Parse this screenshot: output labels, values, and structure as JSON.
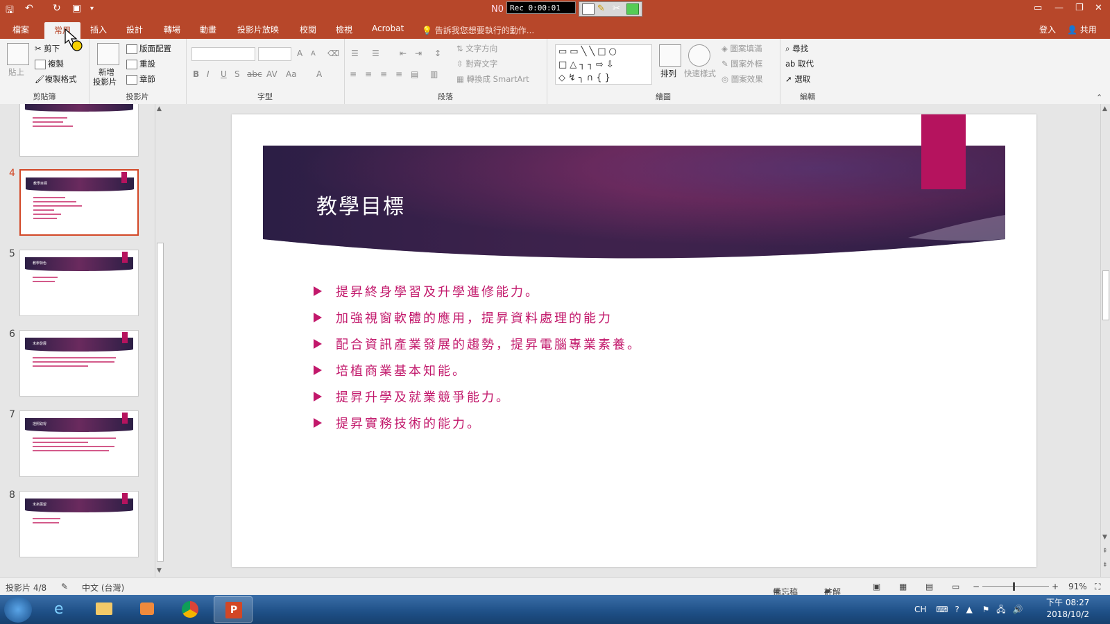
{
  "titlebar": {
    "doc_title": "N0",
    "rec_label": "Rec 0:00:01"
  },
  "tabs": [
    "檔案",
    "常用",
    "插入",
    "設計",
    "轉場",
    "動畫",
    "投影片放映",
    "校閱",
    "檢視",
    "Acrobat"
  ],
  "tell_me": "告訴我您想要執行的動作...",
  "account": {
    "signin": "登入",
    "share": "共用"
  },
  "ribbon": {
    "clipboard": {
      "label": "剪貼簿",
      "paste": "貼上",
      "cut": "剪下",
      "copy": "複製",
      "format_painter": "複製格式"
    },
    "slides": {
      "label": "投影片",
      "new_slide": "新增",
      "new_slide2": "投影片",
      "layout": "版面配置",
      "reset": "重設",
      "section": "章節"
    },
    "font": {
      "label": "字型"
    },
    "paragraph": {
      "label": "段落",
      "text_direction": "文字方向",
      "align_text": "對齊文字",
      "smartart": "轉換成 SmartArt"
    },
    "drawing": {
      "label": "繪圖",
      "arrange": "排列",
      "quick_styles": "快速樣式",
      "fill": "圖案填滿",
      "outline": "圖案外框",
      "effects": "圖案效果"
    },
    "editing": {
      "label": "編輯",
      "find": "尋找",
      "replace": "取代",
      "select": "選取"
    }
  },
  "slides_panel": [
    {
      "num": "",
      "title": ""
    },
    {
      "num": "4",
      "title": "教學目標"
    },
    {
      "num": "5",
      "title": "教學特色"
    },
    {
      "num": "6",
      "title": "未來發展"
    },
    {
      "num": "7",
      "title": "證照取得"
    },
    {
      "num": "8",
      "title": "未來展望"
    }
  ],
  "slide": {
    "title": "教學目標",
    "bullets": [
      "提昇終身學習及升學進修能力。",
      "加強視窗軟體的應用，提昇資料處理的能力",
      "配合資訊產業發展的趨勢，提昇電腦專業素養。",
      "培植商業基本知能。",
      "提昇升學及就業競爭能力。",
      "提昇實務技術的能力。"
    ]
  },
  "status": {
    "slide_indicator": "投影片 4/8",
    "language": "中文 (台灣)",
    "notes": "備忘稿",
    "comments": "註解",
    "zoom": "91%"
  },
  "taskbar": {
    "lang": "CH",
    "time": "下午 08:27",
    "date": "2018/10/2"
  },
  "colors": {
    "titlebar": "#b7472a",
    "accent": "#b5135e",
    "bullet_text": "#c2186b",
    "banner_dark": "#2c1f45",
    "banner_light": "#6a2a5e"
  }
}
